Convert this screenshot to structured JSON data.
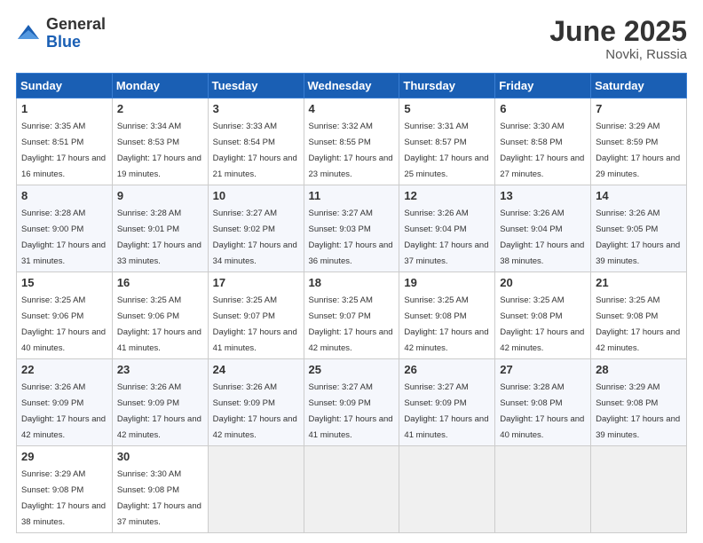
{
  "header": {
    "logo_general": "General",
    "logo_blue": "Blue",
    "month_year": "June 2025",
    "location": "Novki, Russia"
  },
  "days_of_week": [
    "Sunday",
    "Monday",
    "Tuesday",
    "Wednesday",
    "Thursday",
    "Friday",
    "Saturday"
  ],
  "weeks": [
    [
      {
        "day": "1",
        "sunrise": "Sunrise: 3:35 AM",
        "sunset": "Sunset: 8:51 PM",
        "daylight": "Daylight: 17 hours and 16 minutes."
      },
      {
        "day": "2",
        "sunrise": "Sunrise: 3:34 AM",
        "sunset": "Sunset: 8:53 PM",
        "daylight": "Daylight: 17 hours and 19 minutes."
      },
      {
        "day": "3",
        "sunrise": "Sunrise: 3:33 AM",
        "sunset": "Sunset: 8:54 PM",
        "daylight": "Daylight: 17 hours and 21 minutes."
      },
      {
        "day": "4",
        "sunrise": "Sunrise: 3:32 AM",
        "sunset": "Sunset: 8:55 PM",
        "daylight": "Daylight: 17 hours and 23 minutes."
      },
      {
        "day": "5",
        "sunrise": "Sunrise: 3:31 AM",
        "sunset": "Sunset: 8:57 PM",
        "daylight": "Daylight: 17 hours and 25 minutes."
      },
      {
        "day": "6",
        "sunrise": "Sunrise: 3:30 AM",
        "sunset": "Sunset: 8:58 PM",
        "daylight": "Daylight: 17 hours and 27 minutes."
      },
      {
        "day": "7",
        "sunrise": "Sunrise: 3:29 AM",
        "sunset": "Sunset: 8:59 PM",
        "daylight": "Daylight: 17 hours and 29 minutes."
      }
    ],
    [
      {
        "day": "8",
        "sunrise": "Sunrise: 3:28 AM",
        "sunset": "Sunset: 9:00 PM",
        "daylight": "Daylight: 17 hours and 31 minutes."
      },
      {
        "day": "9",
        "sunrise": "Sunrise: 3:28 AM",
        "sunset": "Sunset: 9:01 PM",
        "daylight": "Daylight: 17 hours and 33 minutes."
      },
      {
        "day": "10",
        "sunrise": "Sunrise: 3:27 AM",
        "sunset": "Sunset: 9:02 PM",
        "daylight": "Daylight: 17 hours and 34 minutes."
      },
      {
        "day": "11",
        "sunrise": "Sunrise: 3:27 AM",
        "sunset": "Sunset: 9:03 PM",
        "daylight": "Daylight: 17 hours and 36 minutes."
      },
      {
        "day": "12",
        "sunrise": "Sunrise: 3:26 AM",
        "sunset": "Sunset: 9:04 PM",
        "daylight": "Daylight: 17 hours and 37 minutes."
      },
      {
        "day": "13",
        "sunrise": "Sunrise: 3:26 AM",
        "sunset": "Sunset: 9:04 PM",
        "daylight": "Daylight: 17 hours and 38 minutes."
      },
      {
        "day": "14",
        "sunrise": "Sunrise: 3:26 AM",
        "sunset": "Sunset: 9:05 PM",
        "daylight": "Daylight: 17 hours and 39 minutes."
      }
    ],
    [
      {
        "day": "15",
        "sunrise": "Sunrise: 3:25 AM",
        "sunset": "Sunset: 9:06 PM",
        "daylight": "Daylight: 17 hours and 40 minutes."
      },
      {
        "day": "16",
        "sunrise": "Sunrise: 3:25 AM",
        "sunset": "Sunset: 9:06 PM",
        "daylight": "Daylight: 17 hours and 41 minutes."
      },
      {
        "day": "17",
        "sunrise": "Sunrise: 3:25 AM",
        "sunset": "Sunset: 9:07 PM",
        "daylight": "Daylight: 17 hours and 41 minutes."
      },
      {
        "day": "18",
        "sunrise": "Sunrise: 3:25 AM",
        "sunset": "Sunset: 9:07 PM",
        "daylight": "Daylight: 17 hours and 42 minutes."
      },
      {
        "day": "19",
        "sunrise": "Sunrise: 3:25 AM",
        "sunset": "Sunset: 9:08 PM",
        "daylight": "Daylight: 17 hours and 42 minutes."
      },
      {
        "day": "20",
        "sunrise": "Sunrise: 3:25 AM",
        "sunset": "Sunset: 9:08 PM",
        "daylight": "Daylight: 17 hours and 42 minutes."
      },
      {
        "day": "21",
        "sunrise": "Sunrise: 3:25 AM",
        "sunset": "Sunset: 9:08 PM",
        "daylight": "Daylight: 17 hours and 42 minutes."
      }
    ],
    [
      {
        "day": "22",
        "sunrise": "Sunrise: 3:26 AM",
        "sunset": "Sunset: 9:09 PM",
        "daylight": "Daylight: 17 hours and 42 minutes."
      },
      {
        "day": "23",
        "sunrise": "Sunrise: 3:26 AM",
        "sunset": "Sunset: 9:09 PM",
        "daylight": "Daylight: 17 hours and 42 minutes."
      },
      {
        "day": "24",
        "sunrise": "Sunrise: 3:26 AM",
        "sunset": "Sunset: 9:09 PM",
        "daylight": "Daylight: 17 hours and 42 minutes."
      },
      {
        "day": "25",
        "sunrise": "Sunrise: 3:27 AM",
        "sunset": "Sunset: 9:09 PM",
        "daylight": "Daylight: 17 hours and 41 minutes."
      },
      {
        "day": "26",
        "sunrise": "Sunrise: 3:27 AM",
        "sunset": "Sunset: 9:09 PM",
        "daylight": "Daylight: 17 hours and 41 minutes."
      },
      {
        "day": "27",
        "sunrise": "Sunrise: 3:28 AM",
        "sunset": "Sunset: 9:08 PM",
        "daylight": "Daylight: 17 hours and 40 minutes."
      },
      {
        "day": "28",
        "sunrise": "Sunrise: 3:29 AM",
        "sunset": "Sunset: 9:08 PM",
        "daylight": "Daylight: 17 hours and 39 minutes."
      }
    ],
    [
      {
        "day": "29",
        "sunrise": "Sunrise: 3:29 AM",
        "sunset": "Sunset: 9:08 PM",
        "daylight": "Daylight: 17 hours and 38 minutes."
      },
      {
        "day": "30",
        "sunrise": "Sunrise: 3:30 AM",
        "sunset": "Sunset: 9:08 PM",
        "daylight": "Daylight: 17 hours and 37 minutes."
      },
      null,
      null,
      null,
      null,
      null
    ]
  ]
}
